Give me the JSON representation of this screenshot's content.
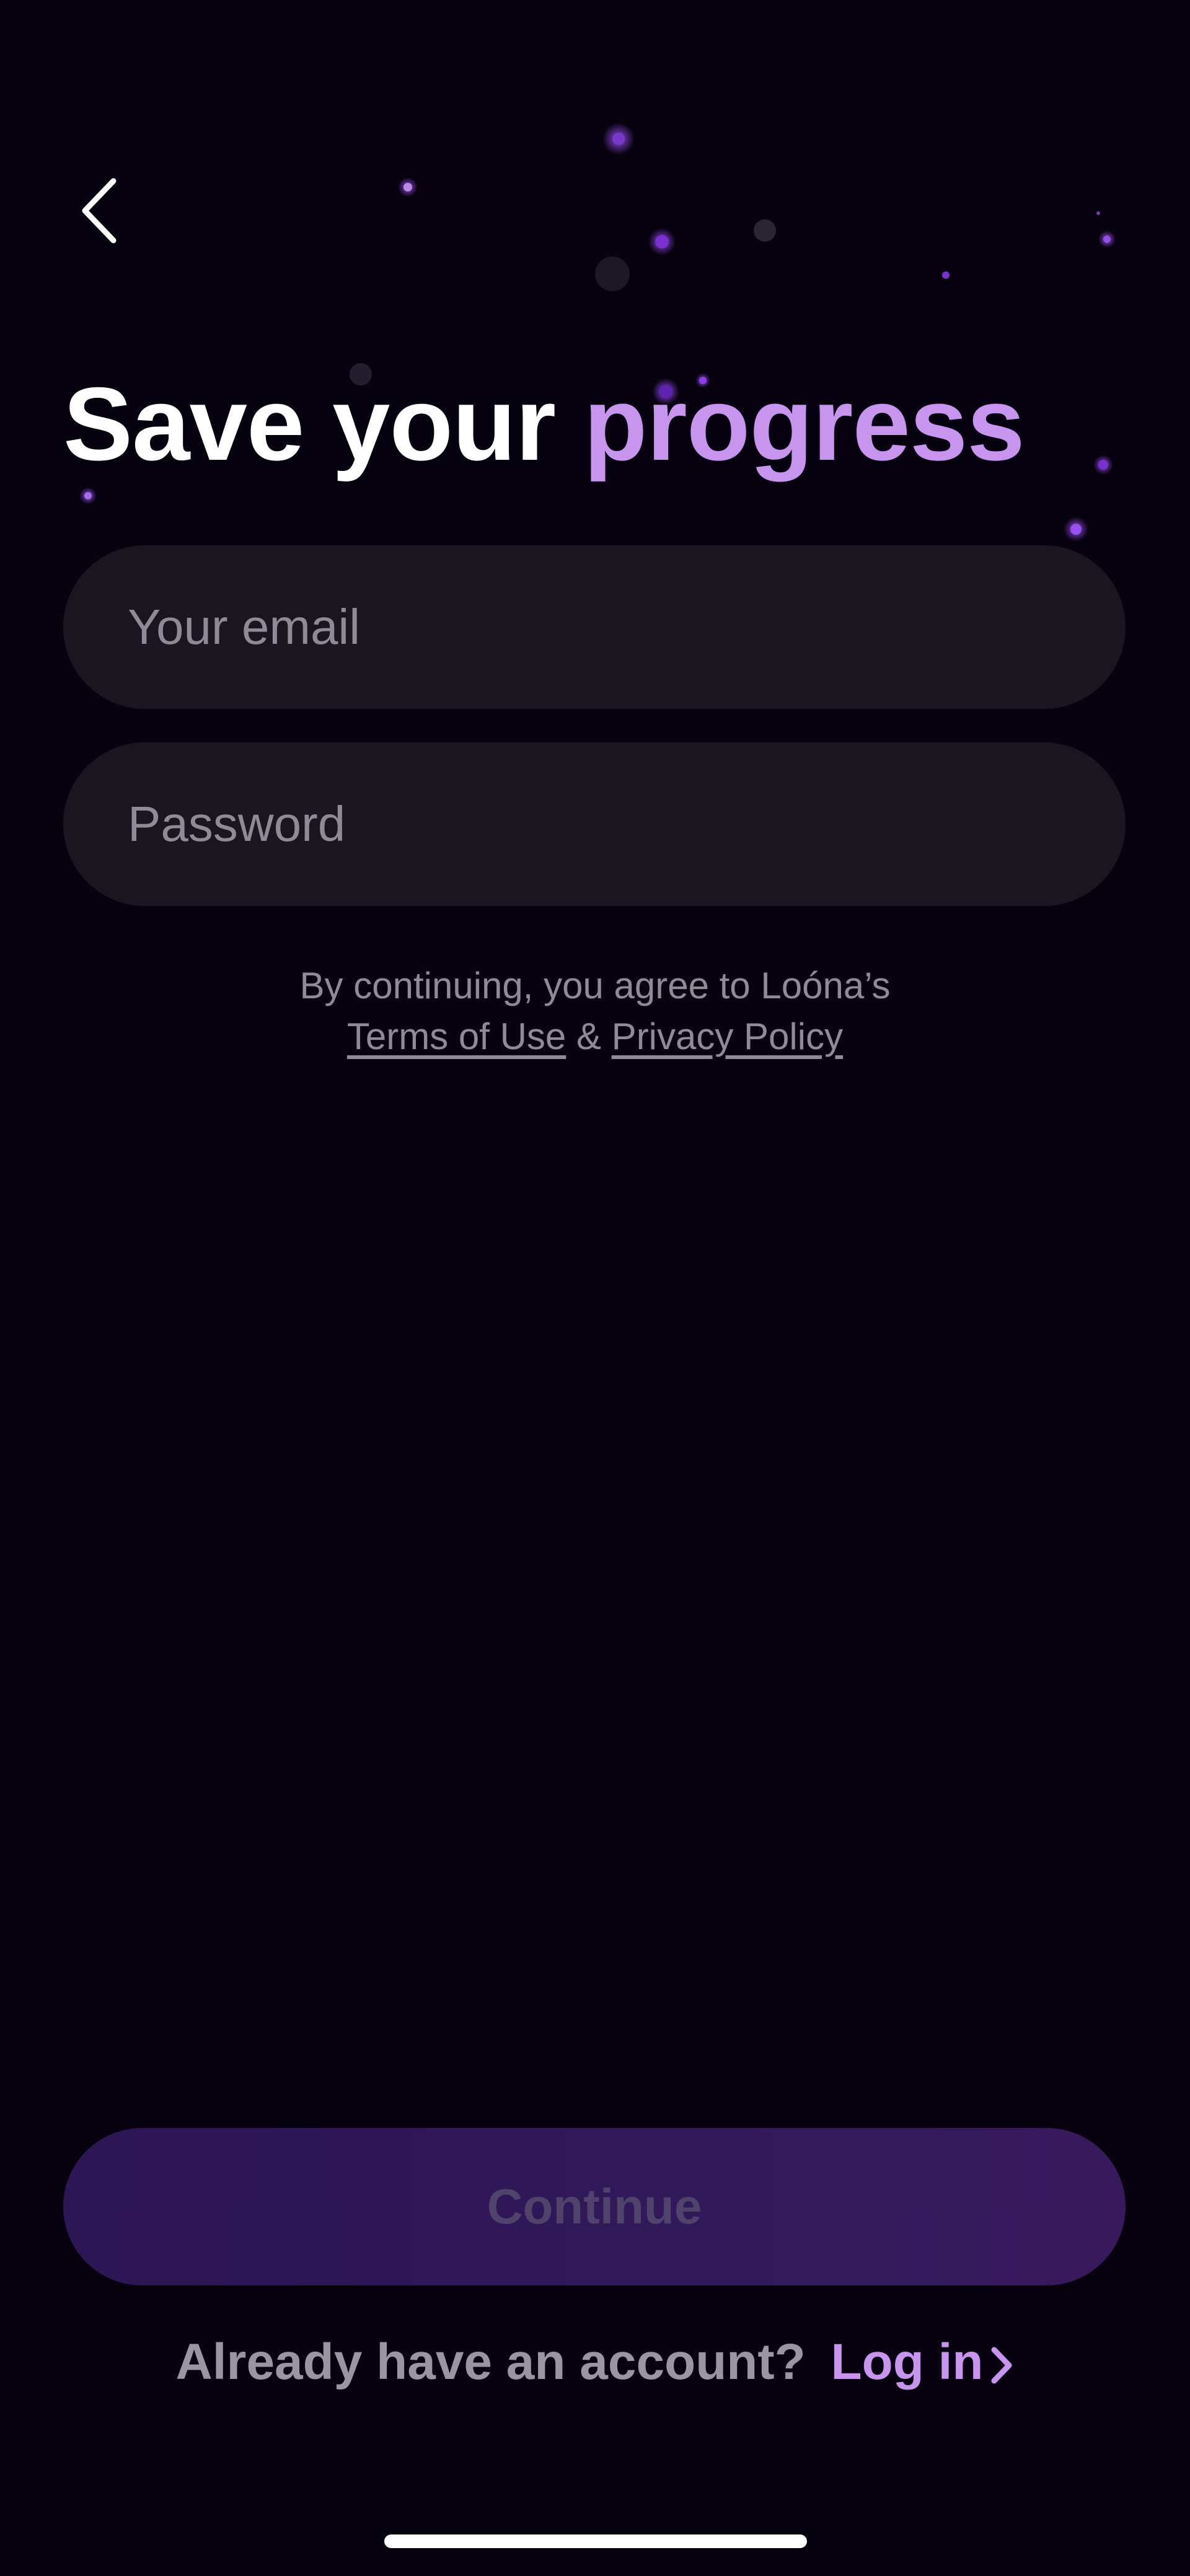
{
  "header": {
    "back_icon": "chevron-left-icon"
  },
  "title": {
    "part1": "Save your ",
    "part2": "progress",
    "accent_color": "#c794ee"
  },
  "form": {
    "email_placeholder": "Your email",
    "password_placeholder": "Password"
  },
  "terms": {
    "prefix": "By continuing, you agree to Loóna’s",
    "terms_link": "Terms of Use",
    "separator": " & ",
    "privacy_link": "Privacy Policy"
  },
  "continue_label": "Continue",
  "login": {
    "prompt": "Already have an account? ",
    "link_label": "Log in",
    "chevron_icon": "chevron-right-icon"
  },
  "colors": {
    "background": "#07020f",
    "field_background": "#1a1620",
    "button_background": "#2f1757",
    "accent": "#c794ee"
  }
}
